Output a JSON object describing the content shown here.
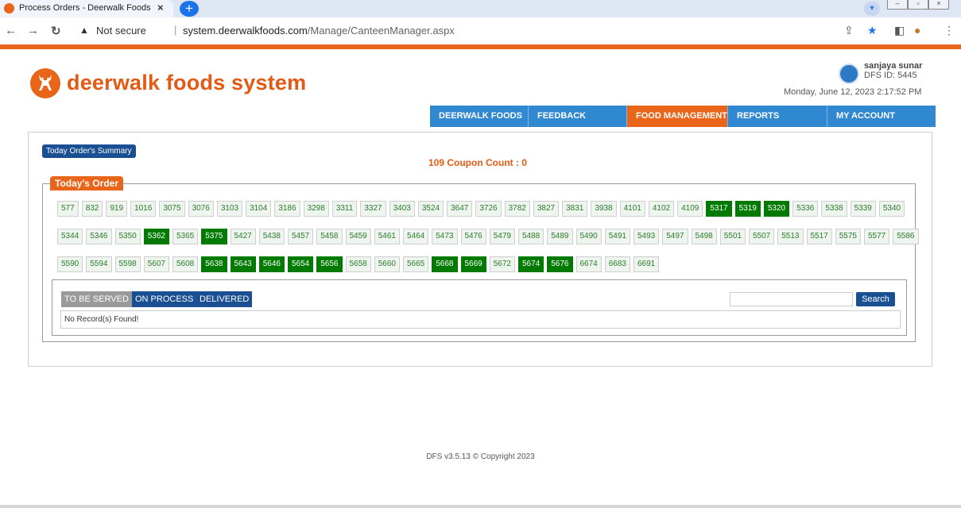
{
  "browser": {
    "tab_title": "Process Orders - Deerwalk Foods",
    "tab_close": "×",
    "new_tab": "+",
    "not_secure": "Not secure",
    "url_domain": "system.deerwalkfoods.com",
    "url_path": "/Manage/CanteenManager.aspx"
  },
  "site": {
    "logo_text": "deerwalk foods system",
    "user_name": "sanjaya sunar",
    "user_id": "DFS ID: 5445",
    "datetime": "Monday, June 12, 2023   2:17:52 PM"
  },
  "menu": {
    "items": [
      "DEERWALK FOODS",
      "FEEDBACK",
      "FOOD MANAGEMENT",
      "REPORTS",
      "MY ACCOUNT"
    ],
    "active": "FOOD MANAGEMENT"
  },
  "main": {
    "summary_button": "Today Order's Summary",
    "coupon_count": "109 Coupon Count : 0",
    "legend": "Today's Order",
    "orders_row1": [
      "577",
      "832",
      "919",
      "1016",
      "3075",
      "3076",
      "3103",
      "3104",
      "3186",
      "3298",
      "3311",
      "3327",
      "3403",
      "3524",
      "3647",
      "3726",
      "3782",
      "3827",
      "3831",
      "3938",
      "4101",
      "4102",
      "4109",
      "5317",
      "5319",
      "5320",
      "5336",
      "5338",
      "5339",
      "5340"
    ],
    "orders_row2": [
      "5344",
      "5346",
      "5350",
      "5362",
      "5365",
      "5375",
      "5427",
      "5438",
      "5457",
      "5458",
      "5459",
      "5461",
      "5464",
      "5473",
      "5476",
      "5479",
      "5488",
      "5489",
      "5490",
      "5491",
      "5493",
      "5497",
      "5498",
      "5501",
      "5507",
      "5513",
      "5517",
      "5575",
      "5577",
      "5586"
    ],
    "orders_row3": [
      "5590",
      "5594",
      "5598",
      "5607",
      "5608",
      "5638",
      "5643",
      "5646",
      "5654",
      "5656",
      "5658",
      "5660",
      "5665",
      "5668",
      "5669",
      "5672",
      "5674",
      "5676",
      "6674",
      "6683",
      "6691"
    ],
    "highlighted_orders": [
      "5317",
      "5319",
      "5320",
      "5362",
      "5375",
      "5638",
      "5643",
      "5646",
      "5654",
      "5656",
      "5668",
      "5669",
      "5674",
      "5676"
    ],
    "status_tabs": {
      "to_be_served": "TO BE SERVED",
      "on_process": "ON PROCESS",
      "delivered": "DELIVERED"
    },
    "search_button": "Search",
    "no_records": "No Record(s) Found!"
  },
  "footer": "DFS v3.5.13 © Copyright 2023",
  "colors": {
    "accent_orange": "#e8651a",
    "menu_blue": "#2f88d0",
    "button_navy": "#1b4f94",
    "order_ready_green": "#007a00"
  }
}
